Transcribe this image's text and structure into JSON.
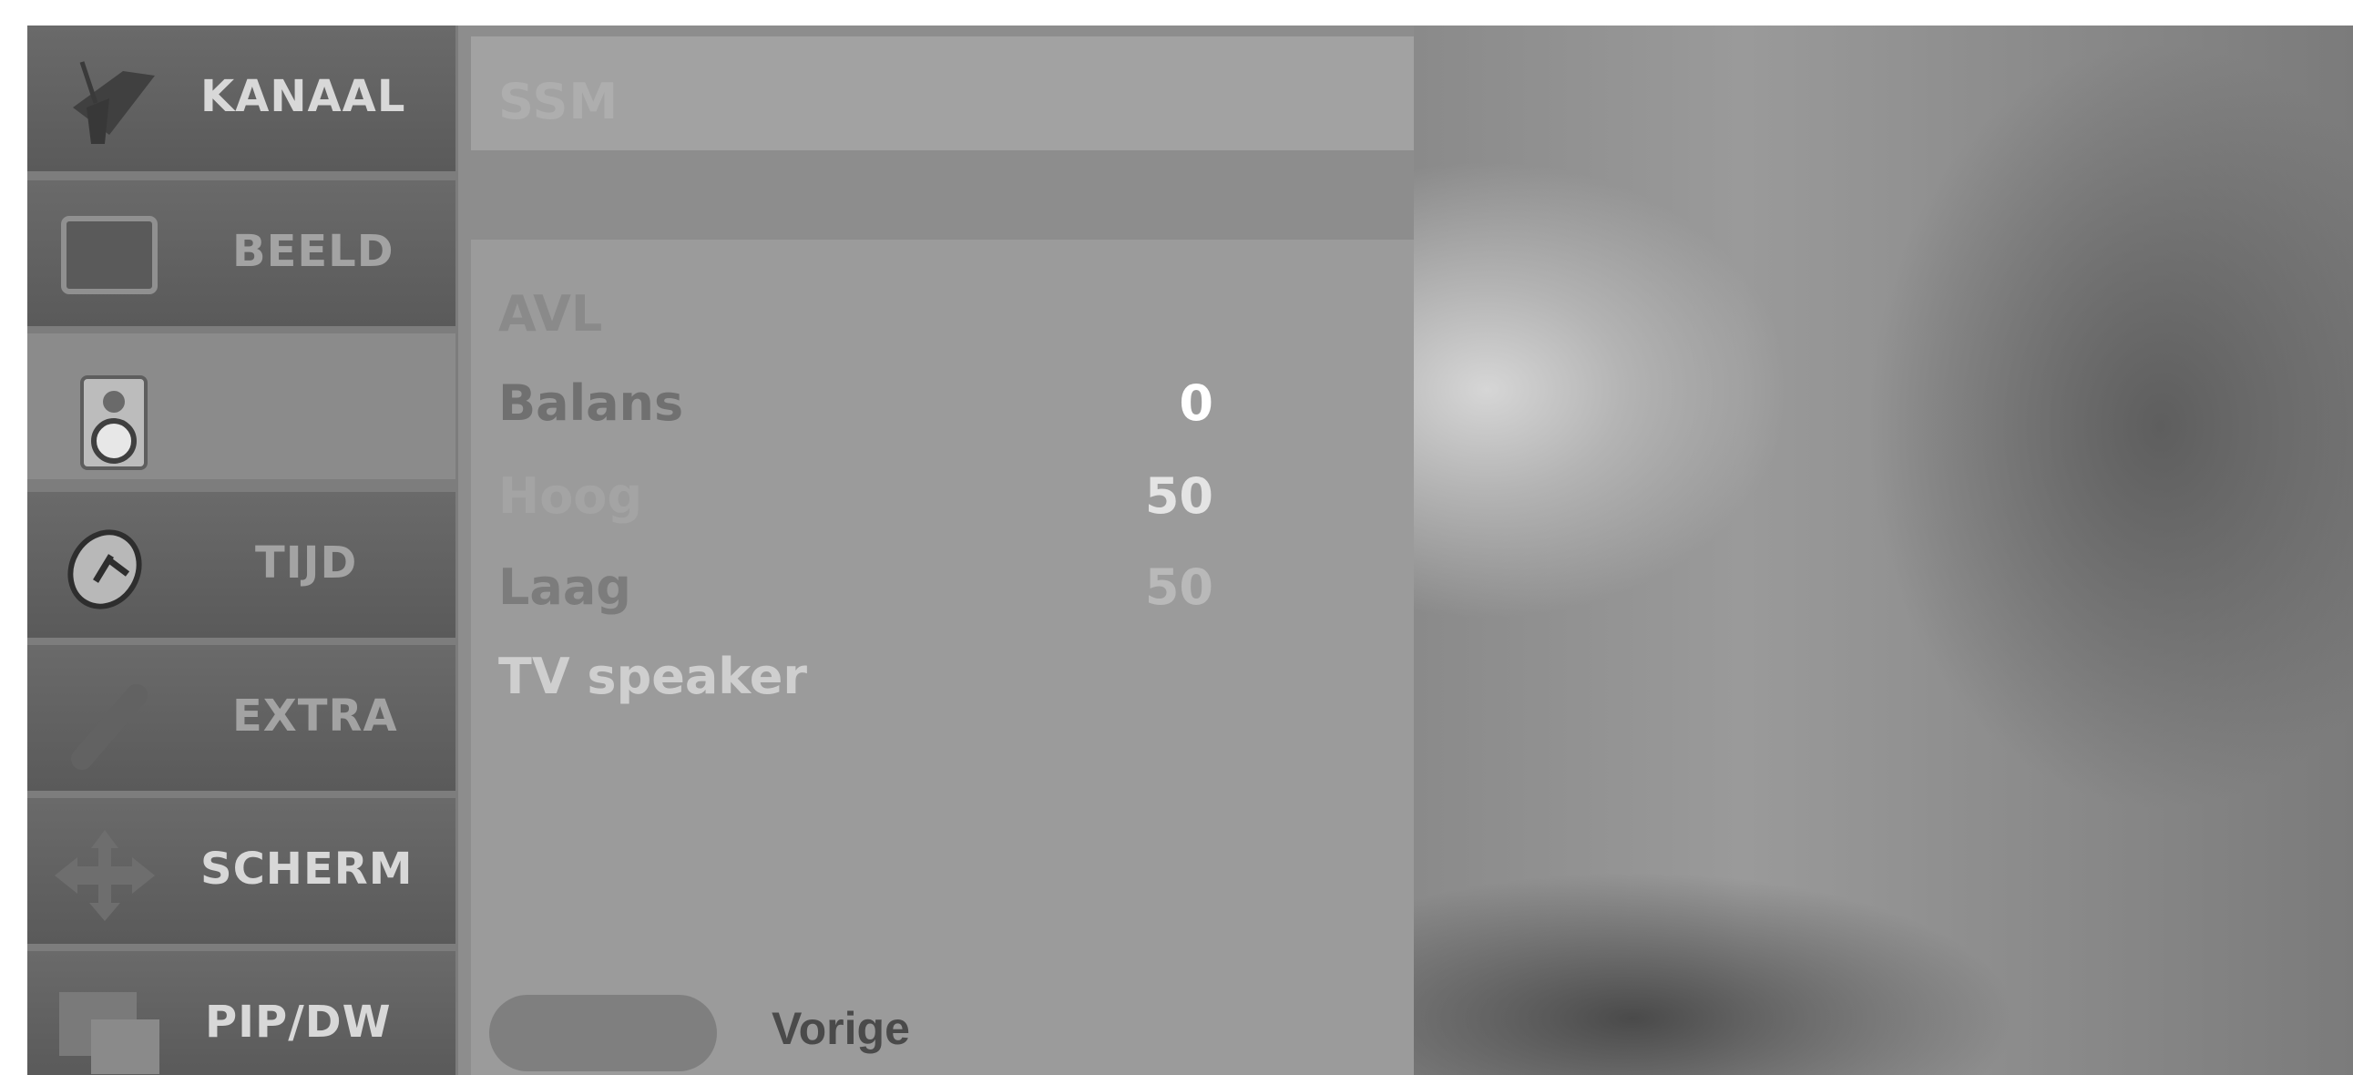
{
  "menu": {
    "items": [
      {
        "label": "KANAAL",
        "icon": "satellite-dish-icon"
      },
      {
        "label": "BEELD",
        "icon": "tv-screen-icon"
      },
      {
        "label": "",
        "icon": "speaker-icon"
      },
      {
        "label": "TIJD",
        "icon": "clock-icon"
      },
      {
        "label": "EXTRA",
        "icon": "extra-icon"
      },
      {
        "label": "SCHERM",
        "icon": "arrows-move-icon"
      },
      {
        "label": "PIP/DW",
        "icon": "pip-windows-icon"
      }
    ]
  },
  "sound": {
    "ssm_label": "SSM",
    "options": [
      {
        "label": "AVL",
        "value": ""
      },
      {
        "label": "Balans",
        "value": "0"
      },
      {
        "label": "Hoog",
        "value": "50"
      },
      {
        "label": "Laag",
        "value": "50"
      },
      {
        "label": "TV speaker",
        "value": ""
      }
    ]
  },
  "footer": {
    "vorige_label": "Vorige"
  },
  "colors": {
    "menu_bg": "#7d7d7d",
    "panel_bg": "#9b9b9b",
    "text_light": "#d8d8d8",
    "text_dim": "#7a7a7a"
  }
}
